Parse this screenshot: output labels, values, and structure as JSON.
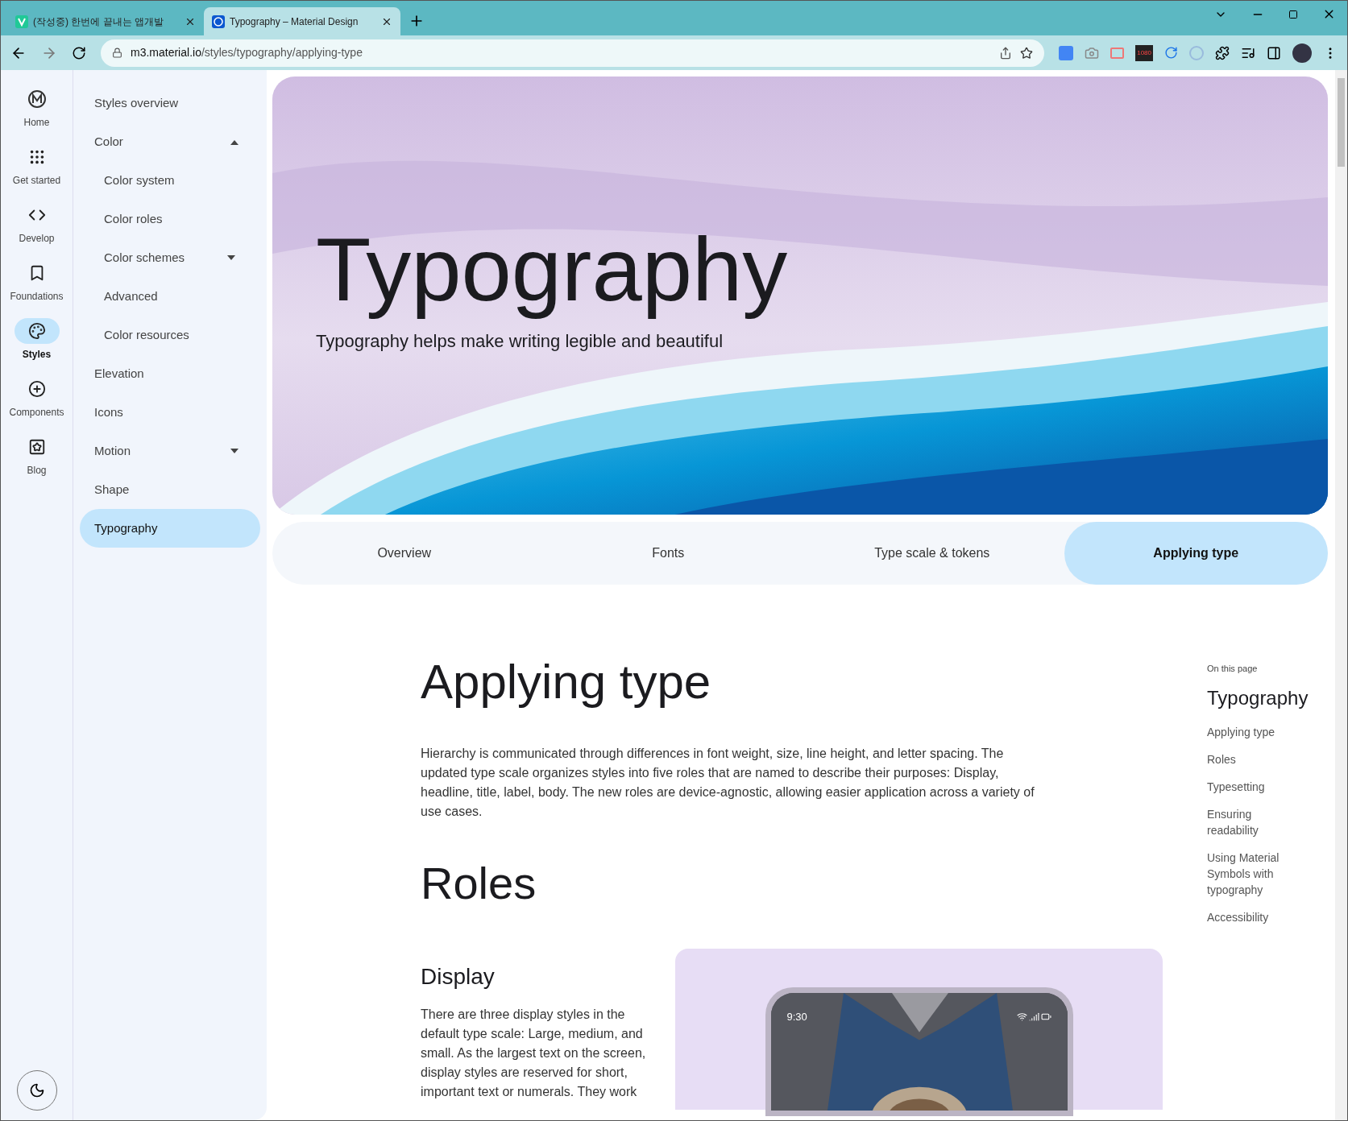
{
  "browser": {
    "tabs": [
      {
        "title": "(작성중) 한번에 끝내는 앱개발",
        "selected": false
      },
      {
        "title": "Typography – Material Design",
        "selected": true
      }
    ],
    "url_host": "m3.material.io",
    "url_path": "/styles/typography/applying-type",
    "extension_badge": "1080"
  },
  "rail": [
    {
      "label": "Home",
      "kind": "logo",
      "selected": false
    },
    {
      "label": "Get started",
      "kind": "grid",
      "selected": false
    },
    {
      "label": "Develop",
      "kind": "code",
      "selected": false
    },
    {
      "label": "Foundations",
      "kind": "book",
      "selected": false
    },
    {
      "label": "Styles",
      "kind": "palette",
      "selected": true
    },
    {
      "label": "Components",
      "kind": "plus",
      "selected": false
    },
    {
      "label": "Blog",
      "kind": "star",
      "selected": false
    }
  ],
  "nav": [
    {
      "label": "Styles overview",
      "selected": false
    },
    {
      "label": "Color",
      "selected": false,
      "expanded": true,
      "children": [
        {
          "label": "Color system",
          "selected": false
        },
        {
          "label": "Color roles",
          "selected": false
        },
        {
          "label": "Color schemes",
          "selected": false,
          "expanded": false
        },
        {
          "label": "Advanced",
          "selected": false
        },
        {
          "label": "Color resources",
          "selected": false
        }
      ]
    },
    {
      "label": "Elevation",
      "selected": false
    },
    {
      "label": "Icons",
      "selected": false
    },
    {
      "label": "Motion",
      "selected": false,
      "expanded": false
    },
    {
      "label": "Shape",
      "selected": false
    },
    {
      "label": "Typography",
      "selected": true
    }
  ],
  "hero": {
    "title": "Typography",
    "subtitle": "Typography helps make writing legible and beautiful"
  },
  "page_tabs": [
    {
      "label": "Overview",
      "selected": false
    },
    {
      "label": "Fonts",
      "selected": false
    },
    {
      "label": "Type scale & tokens",
      "selected": false
    },
    {
      "label": "Applying type",
      "selected": true
    }
  ],
  "article": {
    "heading": "Applying type",
    "intro": "Hierarchy is communicated through differences in font weight, size, line height, and letter spacing. The updated type scale organizes styles into five roles that are named to describe their purposes: Display, headline, title, label, body. The new roles are device-agnostic, allowing easier application across a variety of use cases.",
    "section": "Roles",
    "subsection": "Display",
    "display_text": "There are three display styles in the default type scale: Large, medium, and small. As the largest text on the screen, display styles are reserved for short, important text or numerals. They work",
    "phone_time": "9:30"
  },
  "toc": {
    "caption": "On this page",
    "title": "Typography",
    "items": [
      "Applying type",
      "Roles",
      "Typesetting",
      "Ensuring readability",
      "Using Material Symbols with typography",
      "Accessibility"
    ]
  }
}
